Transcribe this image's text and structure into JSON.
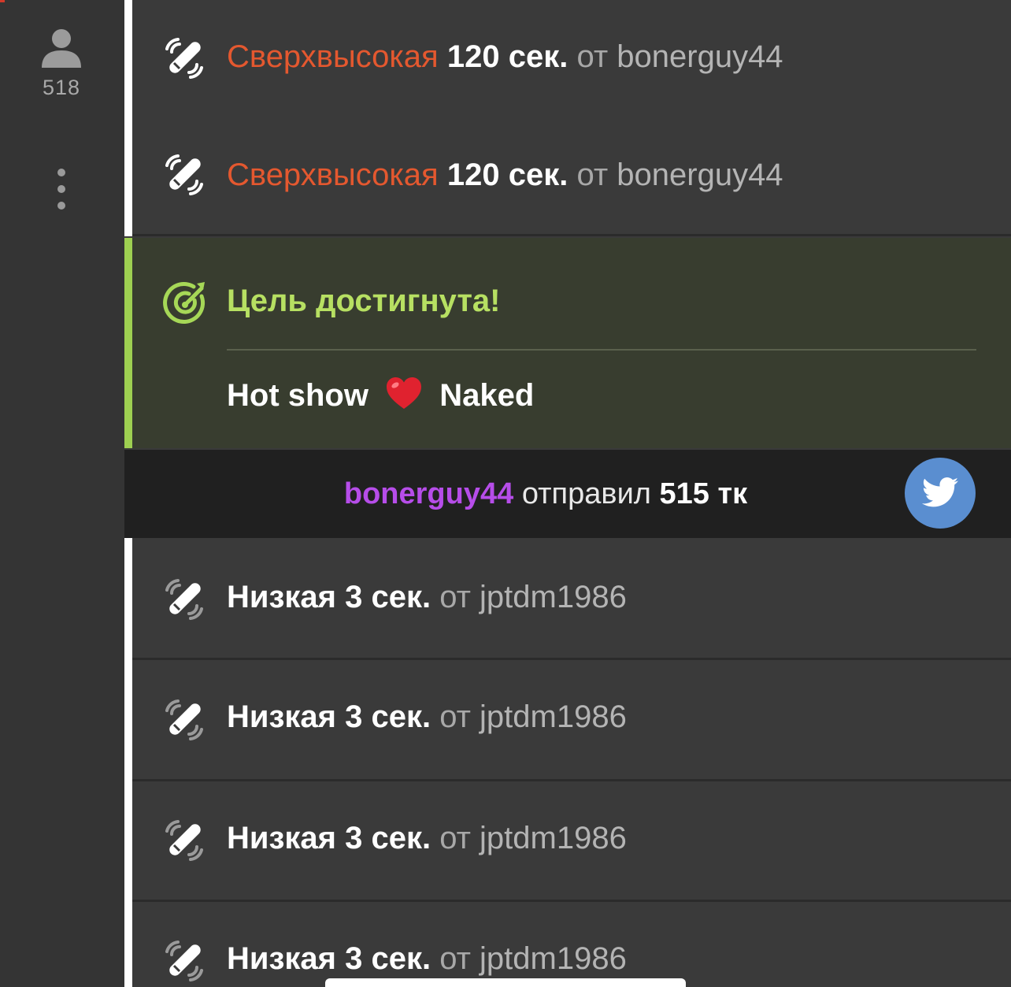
{
  "sidebar": {
    "viewer_count": "518",
    "user_icon": "user-icon",
    "more_icon": "vertical-dots-icon"
  },
  "feed": {
    "vibe_rows_top": [
      {
        "level": "Сверхвысокая",
        "duration": "120 сек.",
        "from": "от",
        "user": "bonerguy44",
        "icon": "vibration-icon"
      },
      {
        "level": "Сверхвысокая",
        "duration": "120 сек.",
        "from": "от",
        "user": "bonerguy44",
        "icon": "vibration-icon"
      }
    ],
    "goal": {
      "title": "Цель достигнута!",
      "desc_before": "Hot show",
      "desc_after": "Naked",
      "icon": "target-icon",
      "emoji": "heart"
    },
    "tip": {
      "user": "bonerguy44",
      "verb": "отправил",
      "amount": "515 тк",
      "share_icon": "twitter-bird-icon"
    },
    "vibe_rows_bottom": [
      {
        "level": "Низкая",
        "duration": "3 сек.",
        "from": "от",
        "user": "jptdm1986",
        "icon": "vibration-icon"
      },
      {
        "level": "Низкая",
        "duration": "3 сек.",
        "from": "от",
        "user": "jptdm1986",
        "icon": "vibration-icon"
      },
      {
        "level": "Низкая",
        "duration": "3 сек.",
        "from": "от",
        "user": "jptdm1986",
        "icon": "vibration-icon"
      },
      {
        "level": "Низкая",
        "duration": "3 сек.",
        "from": "от",
        "user": "jptdm1986",
        "icon": "vibration-icon"
      }
    ]
  },
  "colors": {
    "high_level": "#e4582f",
    "goal_accent": "#9ed051",
    "tipper": "#b64de9",
    "share": "#5a8ed0"
  }
}
